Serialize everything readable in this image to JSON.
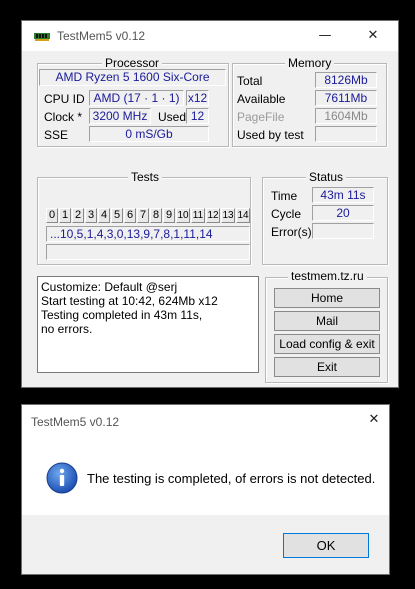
{
  "main": {
    "title": "TestMem5 v0.12",
    "processor": {
      "legend": "Processor",
      "name": "AMD Ryzen 5 1600 Six-Core",
      "cpu_id_label": "CPU ID",
      "cpu_id_value": "AMD  (17 · 1 · 1)",
      "cpu_id_threads": "x12",
      "clock_label": "Clock *",
      "clock_value": "3200 MHz",
      "used_label": "Used",
      "used_value": "12",
      "sse_label": "SSE",
      "sse_value": "0 mS/Gb"
    },
    "memory": {
      "legend": "Memory",
      "total_label": "Total",
      "total_value": "8126Mb",
      "available_label": "Available",
      "available_value": "7611Mb",
      "pagefile_label": "PageFile",
      "pagefile_value": "1604Mb",
      "used_by_test_label": "Used by test",
      "used_by_test_value": ""
    },
    "tests": {
      "legend": "Tests",
      "cells": [
        "0",
        "1",
        "2",
        "3",
        "4",
        "5",
        "6",
        "7",
        "8",
        "9",
        "10",
        "11",
        "12",
        "13",
        "14"
      ],
      "sequence": "...10,5,1,4,3,0,13,9,7,8,1,11,14",
      "progress": ""
    },
    "status": {
      "legend": "Status",
      "time_label": "Time",
      "time_value": "43m 11s",
      "cycle_label": "Cycle",
      "cycle_value": "20",
      "errors_label": "Error(s)",
      "errors_value": ""
    },
    "log": [
      "Customize: Default @serj",
      "Start testing at 10:42, 624Mb x12",
      "Testing completed in 43m 11s,",
      "no errors."
    ],
    "site": "testmem.tz.ru",
    "buttons": {
      "home": "Home",
      "mail": "Mail",
      "load_config": "Load config & exit",
      "exit": "Exit"
    },
    "window_controls": {
      "minimize": "—",
      "close": "✕"
    }
  },
  "dialog": {
    "title": "TestMem5 v0.12",
    "message": "The testing is completed, of errors is not detected.",
    "ok": "OK",
    "icon": "info-icon",
    "close": "✕"
  }
}
